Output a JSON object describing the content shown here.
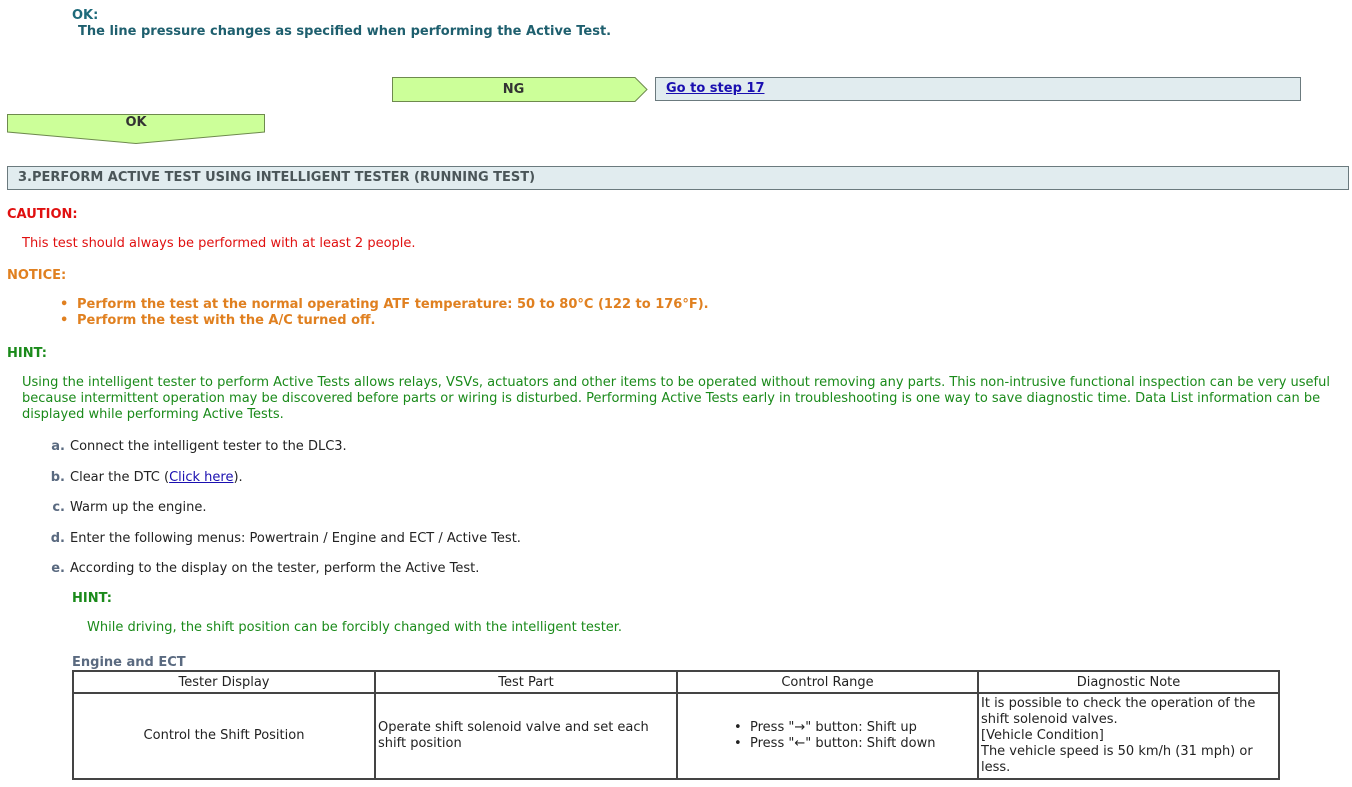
{
  "ok_block": {
    "label": "OK:",
    "text": "The line pressure changes as specified when performing the Active Test."
  },
  "ng_arrow": {
    "label": "NG"
  },
  "goto": {
    "link": "Go to step 17"
  },
  "ok_arrow": {
    "label": "OK"
  },
  "step": {
    "title": "3.PERFORM ACTIVE TEST USING INTELLIGENT TESTER (RUNNING TEST)"
  },
  "caution": {
    "label": "CAUTION:",
    "text": "This test should always be performed with at least 2 people."
  },
  "notice": {
    "label": "NOTICE:",
    "items": [
      "Perform the test at the normal operating ATF temperature: 50 to 80°C (122 to 176°F).",
      "Perform the test with the A/C turned off."
    ]
  },
  "hint": {
    "label": "HINT:",
    "text": "Using the intelligent tester to perform Active Tests allows relays, VSVs, actuators and other items to be operated without removing any parts. This non-intrusive functional inspection can be very useful because intermittent operation may be discovered before parts or wiring is disturbed. Performing Active Tests early in troubleshooting is one way to save diagnostic time. Data List information can be displayed while performing Active Tests."
  },
  "steps": [
    {
      "letter": "a.",
      "text": "Connect the intelligent tester to the DLC3."
    },
    {
      "letter": "b.",
      "text_before": "Clear the DTC (",
      "link": "Click here",
      "text_after": ")."
    },
    {
      "letter": "c.",
      "text": "Warm up the engine."
    },
    {
      "letter": "d.",
      "text": "Enter the following menus: Powertrain / Engine and ECT / Active Test."
    },
    {
      "letter": "e.",
      "text": "According to the display on the tester, perform the Active Test."
    }
  ],
  "hint2": {
    "label": "HINT:",
    "text": "While driving, the shift position can be forcibly changed with the intelligent tester."
  },
  "table": {
    "title": "Engine and ECT",
    "headers": [
      "Tester Display",
      "Test Part",
      "Control Range",
      "Diagnostic Note"
    ],
    "row": {
      "tester_display": "Control the Shift Position",
      "test_part": "Operate shift solenoid valve and set each shift position",
      "control_range": [
        "Press \"→\" button: Shift up",
        "Press \"←\" button: Shift down"
      ],
      "diagnostic_note": [
        "It is possible to check the operation of the shift solenoid valves.",
        "[Vehicle Condition]",
        "The vehicle speed is 50 km/h (31 mph) or less."
      ]
    }
  },
  "colors": {
    "arrow_fill": "#ccff99",
    "box_fill": "#e1ecef",
    "caution": "#e01010",
    "notice": "#e08020",
    "hint": "#1a8a1a",
    "link": "#1a0fb0"
  }
}
